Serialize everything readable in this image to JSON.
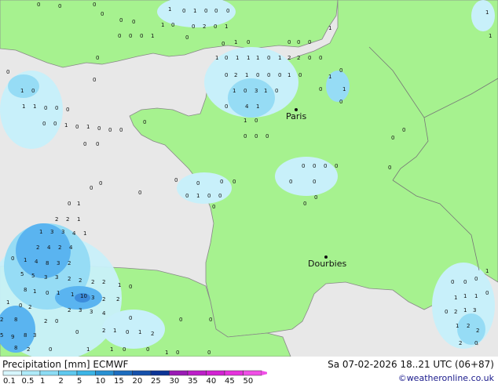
{
  "map": {
    "cities": [
      {
        "name": "Paris"
      },
      {
        "name": "Dourbies"
      }
    ],
    "colors": {
      "sea": "#e8e8e8",
      "land_dry": "#a6f28f",
      "land_light_rain": "#c8f5b0",
      "rain_light": "#c8f0fa",
      "rain_mid": "#96dcf5",
      "rain_heavy": "#5ab4f0",
      "rain_heavier": "#3c8cdc",
      "coast": "#888888",
      "border": "#777777"
    }
  },
  "footer": {
    "title": "Precipitation [mm]  ECMWF",
    "date": "Sa 07-02-2026 18..21 UTC (06+87)",
    "credit": "©weatheronline.co.uk"
  },
  "legend": {
    "ticks": [
      "0.1",
      "0.5",
      "1",
      "2",
      "5",
      "10",
      "15",
      "20",
      "25",
      "30",
      "35",
      "40",
      "45",
      "50"
    ],
    "colors": [
      "#d7f6fc",
      "#aeeaf8",
      "#8cdcf4",
      "#5ec8ee",
      "#3cb4e6",
      "#2890d2",
      "#1c6cbe",
      "#1450aa",
      "#0c3496",
      "#9a1ab4",
      "#bc1ec8",
      "#d222d2",
      "#e632dc",
      "#f050e6"
    ]
  }
}
